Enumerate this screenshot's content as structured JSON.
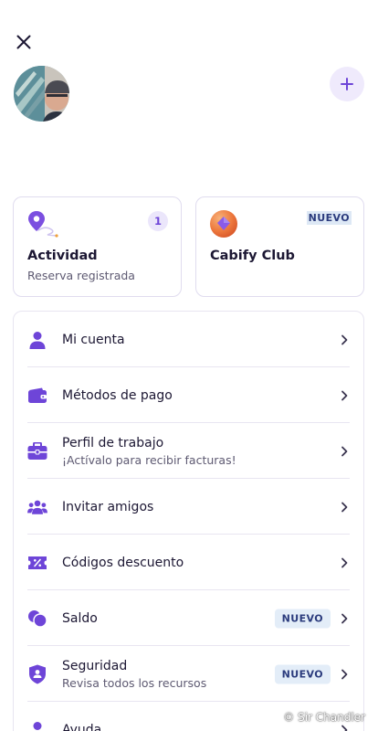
{
  "header": {
    "close_icon": "close-icon",
    "add_icon": "plus-icon"
  },
  "cards": {
    "activity": {
      "title": "Actividad",
      "subtitle": "Reserva registrada",
      "count": "1",
      "icon": "location-route-icon"
    },
    "club": {
      "title": "Cabify Club",
      "tag": "NUEVO",
      "icon": "cabify-club-logo-icon"
    }
  },
  "menu": {
    "items": [
      {
        "label": "Mi cuenta",
        "icon": "person-icon"
      },
      {
        "label": "Métodos de pago",
        "icon": "wallet-icon"
      },
      {
        "label": "Perfil de trabajo",
        "subtitle": "¡Actívalo para recibir facturas!",
        "icon": "briefcase-icon"
      },
      {
        "label": "Invitar amigos",
        "icon": "people-group-icon"
      },
      {
        "label": "Códigos descuento",
        "icon": "discount-ticket-icon"
      },
      {
        "label": "Saldo",
        "tag": "NUEVO",
        "icon": "coins-icon"
      },
      {
        "label": "Seguridad",
        "subtitle": "Revisa todos los recursos",
        "tag": "NUEVO",
        "icon": "shield-icon"
      },
      {
        "label": "Ayuda",
        "icon": "help-icon"
      }
    ]
  },
  "watermark": "© Sir Chandler",
  "colors": {
    "accent": "#6e45d8",
    "tag_bg": "#e3edf8",
    "tag_text": "#2b3b7d",
    "card_border": "#e0dcef"
  }
}
